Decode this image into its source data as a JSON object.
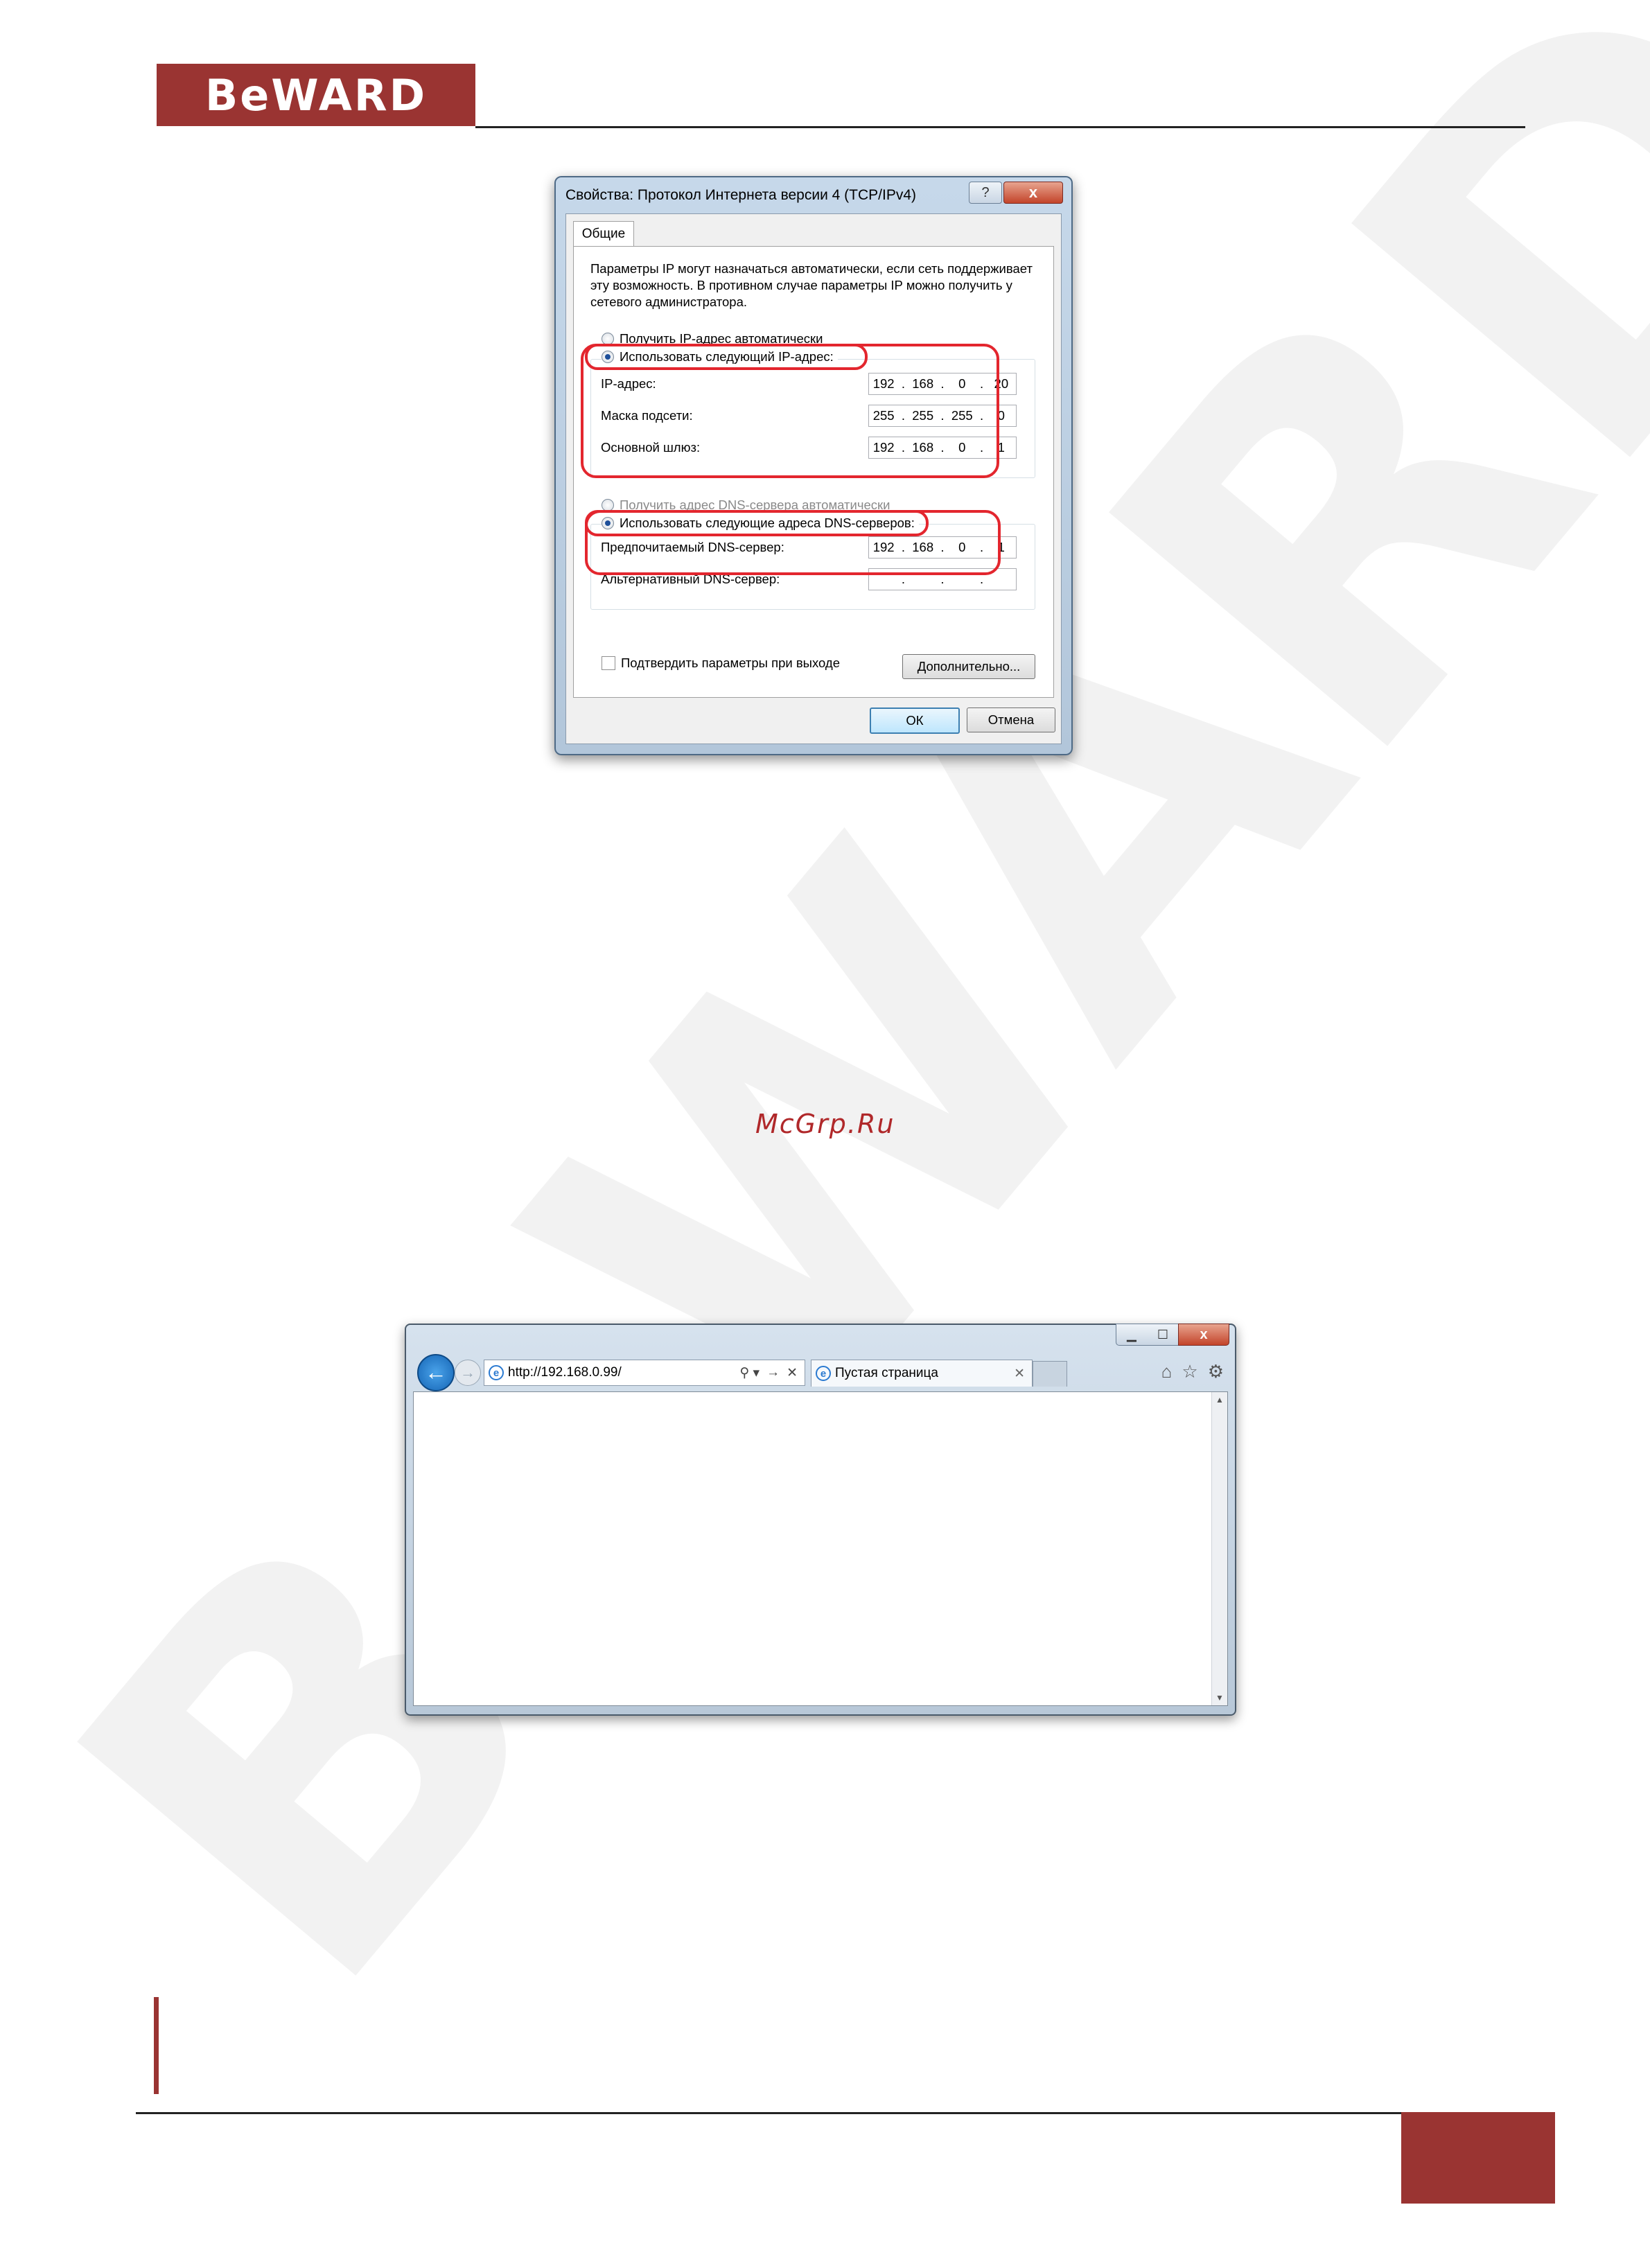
{
  "header": {
    "logo": "BeWARD"
  },
  "watermark": {
    "text": "BeWARD",
    "site": "McGrp.Ru"
  },
  "dialog": {
    "title": "Свойства: Протокол Интернета версии 4 (TCP/IPv4)",
    "help_label": "?",
    "close_label": "x",
    "tab": "Общие",
    "info": "Параметры IP могут назначаться автоматически, если сеть поддерживает эту возможность. В противном случае параметры IP можно получить у сетевого администратора.",
    "ip_auto_label": "Получить IP-адрес автоматически",
    "ip_manual_label": "Использовать следующий IP-адрес:",
    "fields": {
      "ip": {
        "label": "IP-адрес:",
        "octets": [
          "192",
          "168",
          "0",
          "20"
        ]
      },
      "mask": {
        "label": "Маска подсети:",
        "octets": [
          "255",
          "255",
          "255",
          "0"
        ]
      },
      "gateway": {
        "label": "Основной шлюз:",
        "octets": [
          "192",
          "168",
          "0",
          "1"
        ]
      },
      "dns_pref": {
        "label": "Предпочитаемый DNS-сервер:",
        "octets": [
          "192",
          "168",
          "0",
          "1"
        ]
      },
      "dns_alt": {
        "label": "Альтернативный DNS-сервер:",
        "octets": [
          "",
          "",
          "",
          ""
        ]
      }
    },
    "dns_auto_label": "Получить адрес DNS-сервера автоматически",
    "dns_manual_label": "Использовать следующие адреса DNS-серверов:",
    "validate_label": "Подтвердить параметры при выходе",
    "advanced_label": "Дополнительно...",
    "ok_label": "ОК",
    "cancel_label": "Отмена",
    "highlight_color": "#e3262e"
  },
  "browser": {
    "back_icon": "←",
    "forward_icon": "→",
    "url": "http://192.168.0.99/",
    "addr_search": "⚲ ▾",
    "addr_go": "→",
    "addr_stop": "✕",
    "tab_title": "Пустая страница",
    "tab_close": "✕",
    "tools": {
      "home": "⌂",
      "favorites": "☆",
      "settings": "⚙"
    },
    "window_controls": {
      "minimize": "▁",
      "maximize": "☐",
      "close": "x"
    }
  },
  "colors": {
    "brand": "#9a3432"
  }
}
